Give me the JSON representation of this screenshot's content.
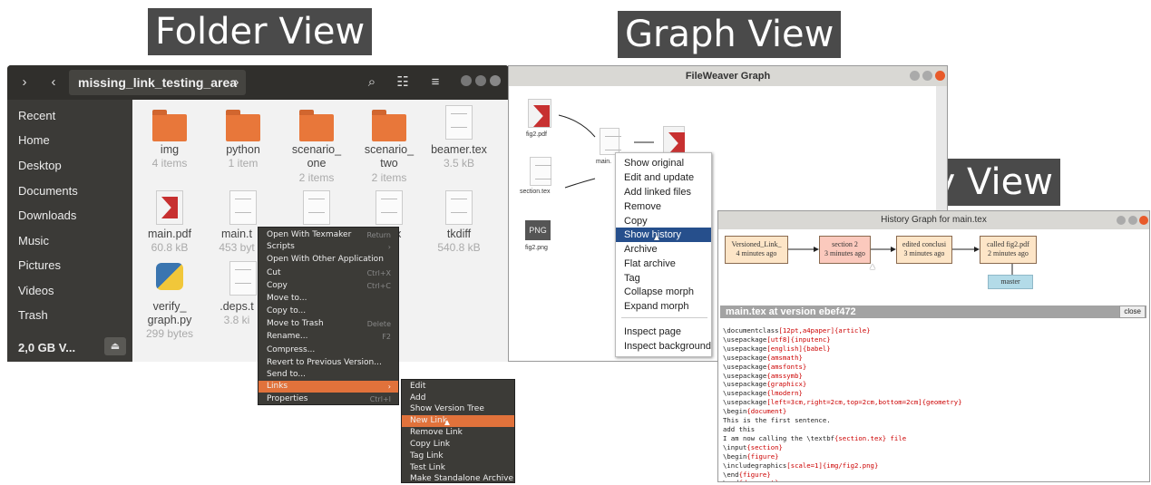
{
  "titles": {
    "folder": "Folder View",
    "graph": "Graph View",
    "history": "History View"
  },
  "folder_view": {
    "path": "missing_link_testing_area",
    "sidebar": [
      "Recent",
      "Home",
      "Desktop",
      "Documents",
      "Downloads",
      "Music",
      "Pictures",
      "Videos",
      "Trash"
    ],
    "device": "2,0 GB V...",
    "files": [
      {
        "name": "img",
        "sub": "4 items",
        "kind": "folder"
      },
      {
        "name": "python",
        "sub": "1 item",
        "kind": "folder"
      },
      {
        "name": "scenario_\none",
        "sub": "2 items",
        "kind": "folder"
      },
      {
        "name": "scenario_\ntwo",
        "sub": "2 items",
        "kind": "folder"
      },
      {
        "name": "beamer.tex",
        "sub": "3.5 kB",
        "kind": "doc"
      },
      {
        "name": "main.pdf",
        "sub": "60.8 kB",
        "kind": "pdf"
      },
      {
        "name": "main.t",
        "sub": "453 byt",
        "kind": "doc"
      },
      {
        "name": "",
        "sub": "",
        "kind": "doc"
      },
      {
        "name": "tex",
        "sub": "es",
        "kind": "doc"
      },
      {
        "name": "tkdiff",
        "sub": "540.8 kB",
        "kind": "doc"
      },
      {
        "name": "verify_\ngraph.py",
        "sub": "299 bytes",
        "kind": "py"
      },
      {
        "name": ".deps.t",
        "sub": "3.8 ki",
        "kind": "doc"
      }
    ],
    "context_menu": [
      {
        "label": "Open With Texmaker",
        "shortcut": "Return"
      },
      {
        "label": "Scripts",
        "shortcut": "›"
      },
      {
        "label": "Open With Other Application",
        "shortcut": ""
      },
      {
        "label": "Cut",
        "shortcut": "Ctrl+X"
      },
      {
        "label": "Copy",
        "shortcut": "Ctrl+C"
      },
      {
        "label": "Move to...",
        "shortcut": ""
      },
      {
        "label": "Copy to...",
        "shortcut": ""
      },
      {
        "label": "Move to Trash",
        "shortcut": "Delete"
      },
      {
        "label": "Rename...",
        "shortcut": "F2"
      },
      {
        "label": "Compress...",
        "shortcut": ""
      },
      {
        "label": "Revert to Previous Version...",
        "shortcut": ""
      },
      {
        "label": "Send to...",
        "shortcut": ""
      },
      {
        "label": "Links",
        "shortcut": "›"
      },
      {
        "label": "Properties",
        "shortcut": "Ctrl+I"
      }
    ],
    "links_submenu": [
      "Edit",
      "Add",
      "Show Version Tree",
      "New Link",
      "Remove Link",
      "Copy Link",
      "Tag Link",
      "Test Link",
      "Make Standalone Archive"
    ]
  },
  "graph_view": {
    "title": "FileWeaver Graph",
    "nodes": [
      "fig2.pdf",
      "section.tex",
      "fig2.png",
      "main.",
      "PNG"
    ],
    "menu": [
      "Show original",
      "Edit and update",
      "Add linked files",
      "Remove",
      "Copy",
      "Show history",
      "Archive",
      "Flat archive",
      "Tag",
      "Collapse morph",
      "Expand morph",
      "Inspect page",
      "Inspect background"
    ]
  },
  "history_view": {
    "title": "History Graph for main.tex",
    "nodes": [
      {
        "line1": "Versioned_Link_",
        "line2": "4 minutes ago"
      },
      {
        "line1": "section 2",
        "line2": "3 minutes ago"
      },
      {
        "line1": "edited conclusi",
        "line2": "3 minutes ago"
      },
      {
        "line1": "called fig2.pdf",
        "line2": "2 minutes ago"
      }
    ],
    "branch": "master",
    "version_bar": "main.tex at version ebef472",
    "close_label": "close",
    "code": [
      [
        "\\documentclass",
        "[12pt,a4paper]{article}"
      ],
      [
        "\\usepackage",
        "[utf8]{inputenc}"
      ],
      [
        "\\usepackage",
        "[english]{babel}"
      ],
      [
        "\\usepackage",
        "{amsmath}"
      ],
      [
        "\\usepackage",
        "{amsfonts}"
      ],
      [
        "\\usepackage",
        "{amssymb}"
      ],
      [
        "\\usepackage",
        "{graphicx}"
      ],
      [
        "\\usepackage",
        "{lmodern}"
      ],
      [
        "\\usepackage",
        "[left=3cm,right=2cm,top=2cm,bottom=2cm]{geometry}"
      ],
      [
        "\\begin",
        "{document}"
      ],
      [
        "This is the first sentence.",
        ""
      ],
      [
        "add this",
        ""
      ],
      [
        "I am now calling the \\textbf",
        "{section.tex} file"
      ],
      [
        "\\input",
        "{section}"
      ],
      [
        "\\begin",
        "{figure}"
      ],
      [
        "\\includegraphics",
        "[scale=1]{img/fig2.png}"
      ],
      [
        "\\end",
        "{figure}"
      ],
      [
        "\\end",
        "{document}"
      ]
    ]
  }
}
